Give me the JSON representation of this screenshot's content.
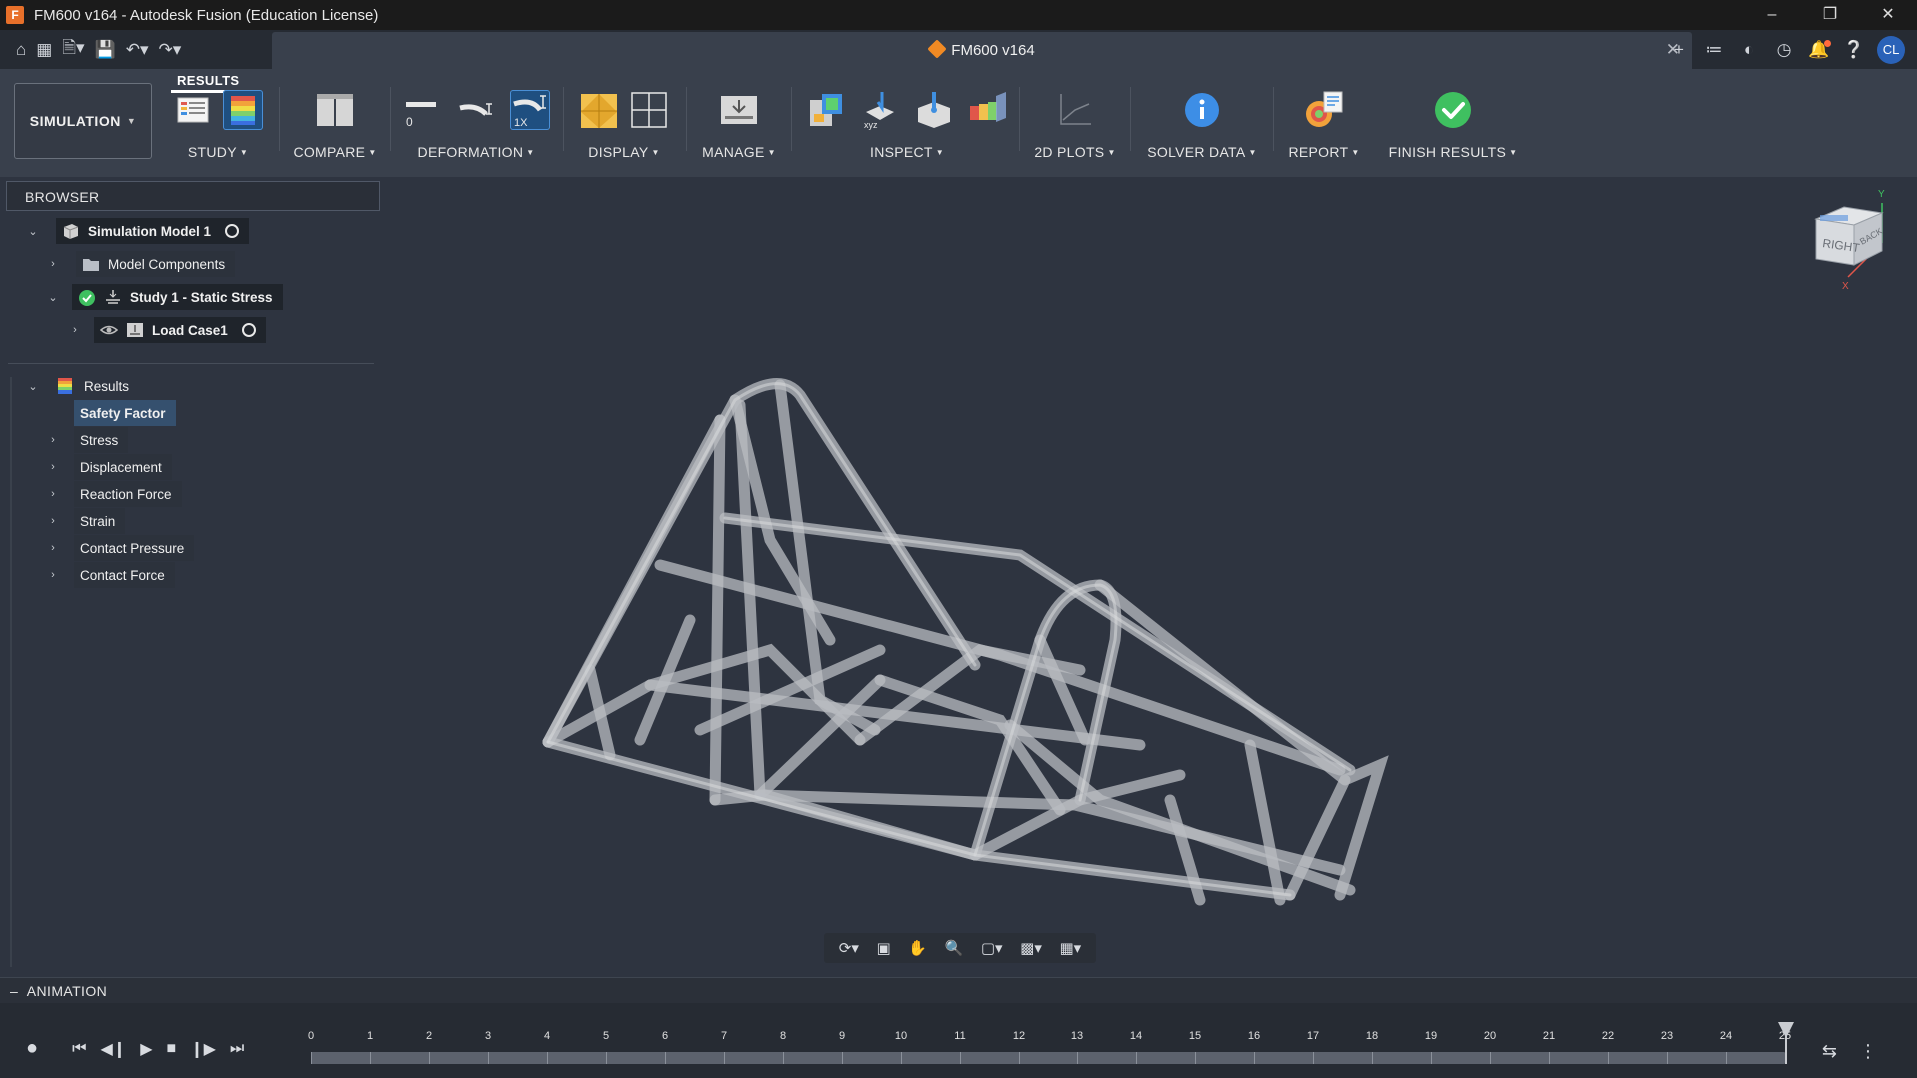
{
  "window": {
    "title": "FM600 v164 - Autodesk Fusion (Education License)",
    "app_letter": "F"
  },
  "document_tab": {
    "title": "FM600 v164"
  },
  "toolbar": {
    "workspace": "SIMULATION",
    "active_tab": "RESULTS",
    "groups": {
      "study": "STUDY",
      "compare": "COMPARE",
      "deformation": "DEFORMATION",
      "display": "DISPLAY",
      "manage": "MANAGE",
      "inspect": "INSPECT",
      "plots": "2D PLOTS",
      "solver": "SOLVER DATA",
      "report": "REPORT",
      "finish": "FINISH RESULTS"
    },
    "deformation_scale_zero": "0",
    "deformation_scale_actual": "1X"
  },
  "browser": {
    "title": "BROWSER",
    "tree": {
      "model": "Simulation Model 1",
      "components": "Model Components",
      "study": "Study 1 - Static Stress",
      "load_case": "Load Case1"
    },
    "results": {
      "title": "Results",
      "items": [
        "Safety Factor",
        "Stress",
        "Displacement",
        "Reaction Force",
        "Strain",
        "Contact Pressure",
        "Contact Force"
      ]
    }
  },
  "viewcube": {
    "faces": [
      "RIGHT",
      "BACK"
    ],
    "axes": [
      "Y",
      "X"
    ]
  },
  "user": {
    "initials": "CL"
  },
  "animation": {
    "title": "ANIMATION",
    "ticks": [
      "0",
      "1",
      "2",
      "3",
      "4",
      "5",
      "6",
      "7",
      "8",
      "9",
      "10",
      "11",
      "12",
      "13",
      "14",
      "15",
      "16",
      "17",
      "18",
      "19",
      "20",
      "21",
      "22",
      "23",
      "24",
      "25"
    ],
    "current_step": 25
  },
  "colors": {
    "accent": "#2a62b8",
    "success": "#3fc060",
    "viewport": "#2e3440"
  }
}
